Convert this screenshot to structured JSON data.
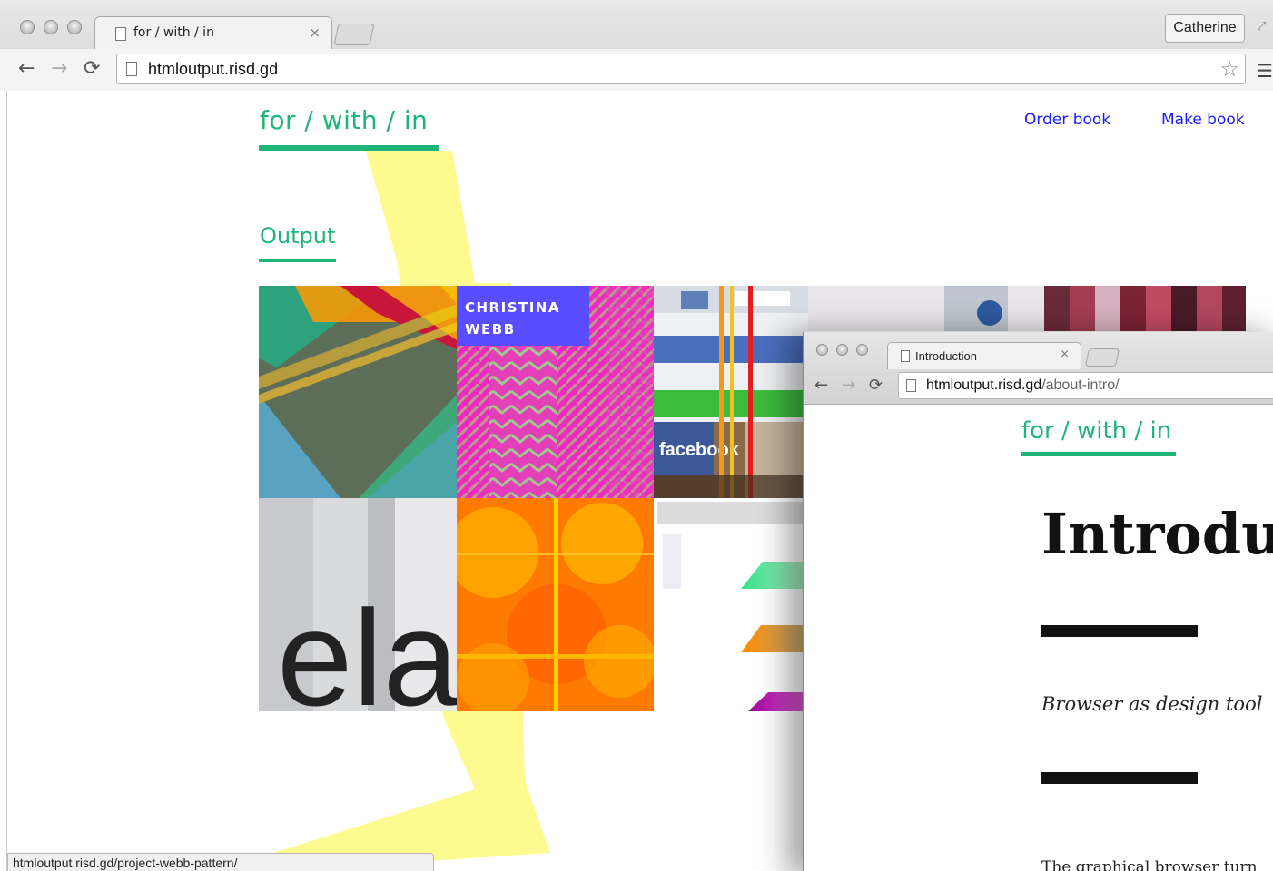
{
  "browser": {
    "tab_title": "for / with / in",
    "tab_close": "×",
    "profile_name": "Catherine",
    "url": "htmloutput.risd.gd",
    "back_glyph": "←",
    "forward_glyph": "→",
    "reload_glyph": "⟳",
    "star_glyph": "☆",
    "menu_glyph": "☰",
    "fullscreen_glyph": "⤢"
  },
  "site": {
    "logo": "for / with / in",
    "nav": [
      {
        "label": "Order book"
      },
      {
        "label": "Make book"
      }
    ],
    "section_heading": "Output",
    "projects": [
      {
        "id": "geometric-pattern",
        "badge": ""
      },
      {
        "id": "webb-pattern",
        "badge_line1": "CHRISTINA",
        "badge_line2": "WEBB"
      },
      {
        "id": "web-collage",
        "badge": ""
      },
      {
        "id": "pixel-mosaic",
        "badge": ""
      },
      {
        "id": "type-photo",
        "badge": ""
      },
      {
        "id": "orange-fractal",
        "badge": ""
      },
      {
        "id": "gradient-screens",
        "badge": ""
      }
    ],
    "collage_text": "facebook",
    "type_photo_text": "ela"
  },
  "status_bar": {
    "url": "htmloutput.risd.gd/project-webb-pattern/"
  },
  "overlay_window": {
    "tab_title": "Introduction",
    "tab_close": "×",
    "url_host": "htmloutput.risd.gd",
    "url_path": "/about-intro/",
    "back_glyph": "←",
    "forward_glyph": "→",
    "reload_glyph": "⟳",
    "logo": "for / with / in",
    "title": "Introduc",
    "subtitle": "Browser as design tool",
    "body_fragment": "The graphical browser turn"
  },
  "colors": {
    "brand_green": "#1fb579",
    "link_blue": "#1a1aff",
    "highlight_yellow": "#fdfb8f",
    "badge_purple": "#5a4cff"
  }
}
